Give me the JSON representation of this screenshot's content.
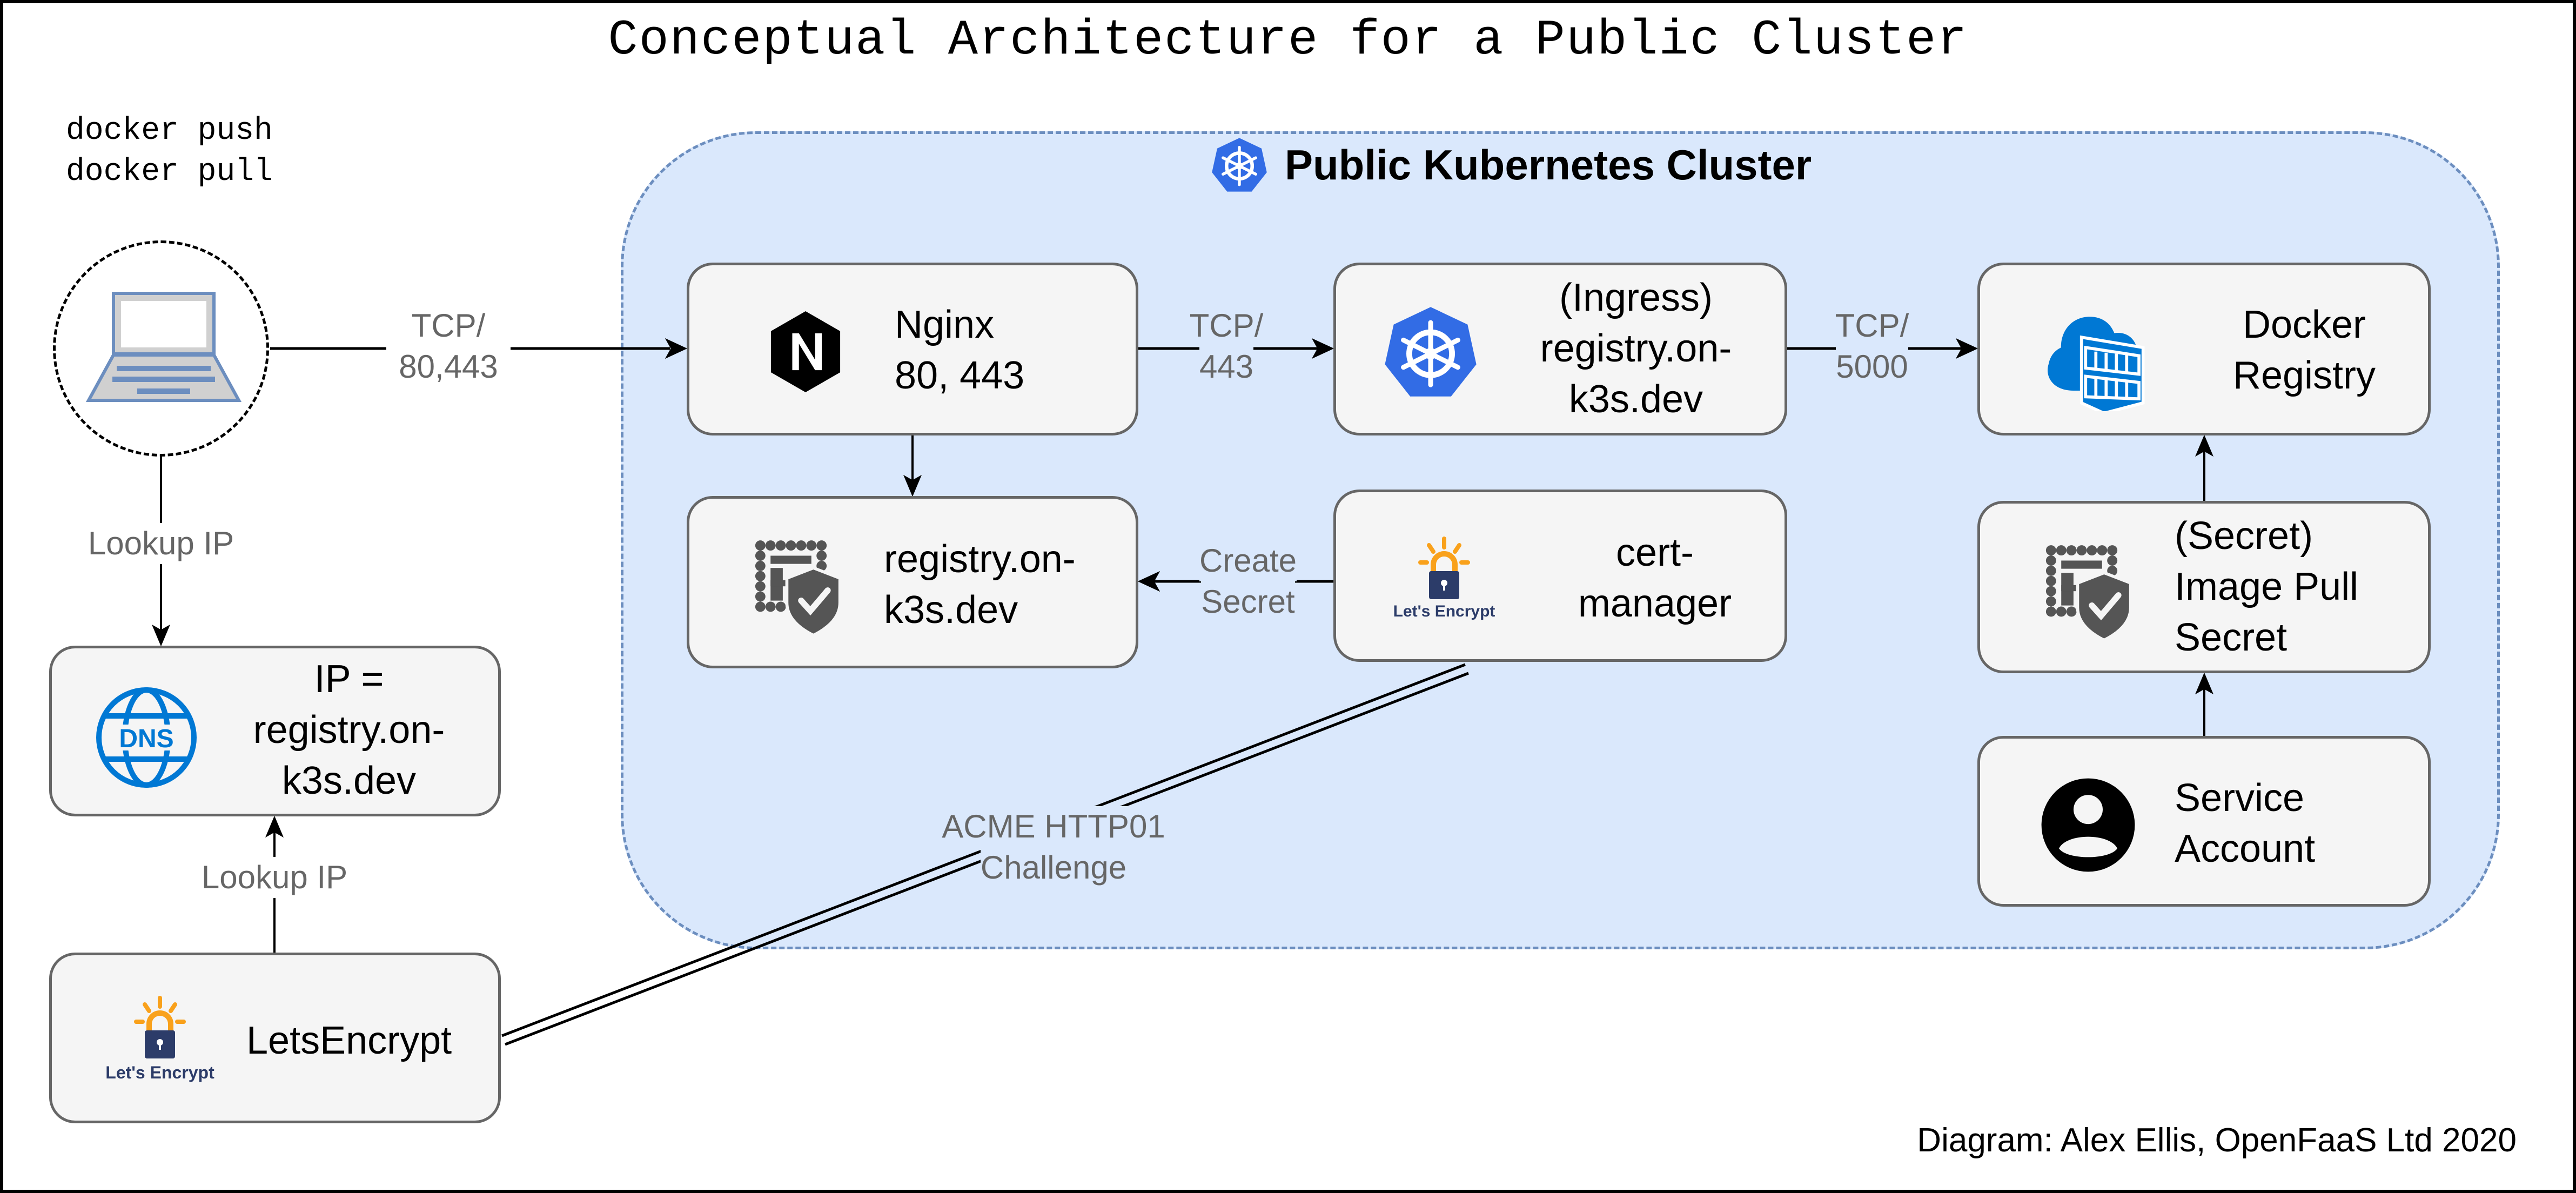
{
  "title": "Conceptual Architecture for a Public Cluster",
  "commands": [
    "docker push",
    "docker pull"
  ],
  "cluster": {
    "title": "Public Kubernetes Cluster",
    "icon": "kubernetes-icon",
    "fill_color": "#dae8fc",
    "border_color": "#6c8ebf"
  },
  "nodes": {
    "client": {
      "icon": "laptop-icon"
    },
    "nginx": {
      "icon": "nginx-icon",
      "lines": [
        "Nginx",
        "80, 443"
      ]
    },
    "ingress": {
      "icon": "kubernetes-icon",
      "lines": [
        "(Ingress)",
        "registry.on-",
        "k3s.dev"
      ]
    },
    "docker_registry": {
      "icon": "azure-container-registry-icon",
      "lines": [
        "Docker",
        "Registry"
      ]
    },
    "tls_secret": {
      "icon": "certificate-shield-icon",
      "lines": [
        "registry.on-",
        "k3s.dev"
      ]
    },
    "cert_manager": {
      "icon": "letsencrypt-icon",
      "icon_text": "Let's Encrypt",
      "lines": [
        "cert-",
        "manager"
      ]
    },
    "image_pull_secret": {
      "icon": "certificate-shield-icon",
      "lines": [
        "(Secret)",
        "Image Pull",
        "Secret"
      ]
    },
    "service_account": {
      "icon": "user-account-icon",
      "lines": [
        "Service",
        "Account"
      ]
    },
    "dns": {
      "icon": "dns-globe-icon",
      "icon_text": "DNS",
      "lines": [
        "IP =",
        "registry.on-",
        "k3s.dev"
      ]
    },
    "letsencrypt": {
      "icon": "letsencrypt-icon",
      "icon_text": "Let's Encrypt",
      "lines": [
        "LetsEncrypt"
      ]
    }
  },
  "edges": {
    "client_to_nginx": [
      "TCP/",
      "80,443"
    ],
    "nginx_to_ingress": [
      "TCP/",
      "443"
    ],
    "ingress_to_registry": [
      "TCP/",
      "5000"
    ],
    "certmanager_to_secret": [
      "Create",
      "Secret"
    ],
    "client_to_dns": [
      "Lookup IP"
    ],
    "letsencrypt_to_dns": [
      "Lookup IP"
    ],
    "acme_challenge": [
      "ACME HTTP01",
      "Challenge"
    ]
  },
  "colors": {
    "node_fill": "#f5f5f5",
    "node_border": "#666666",
    "edge_label": "#666666",
    "k8s_blue": "#326ce5",
    "azure_blue": "#0078d4",
    "letsencrypt_orange": "#f9a11b",
    "letsencrypt_navy": "#2c3c69"
  },
  "credit": "Diagram: Alex Ellis, OpenFaaS Ltd 2020"
}
